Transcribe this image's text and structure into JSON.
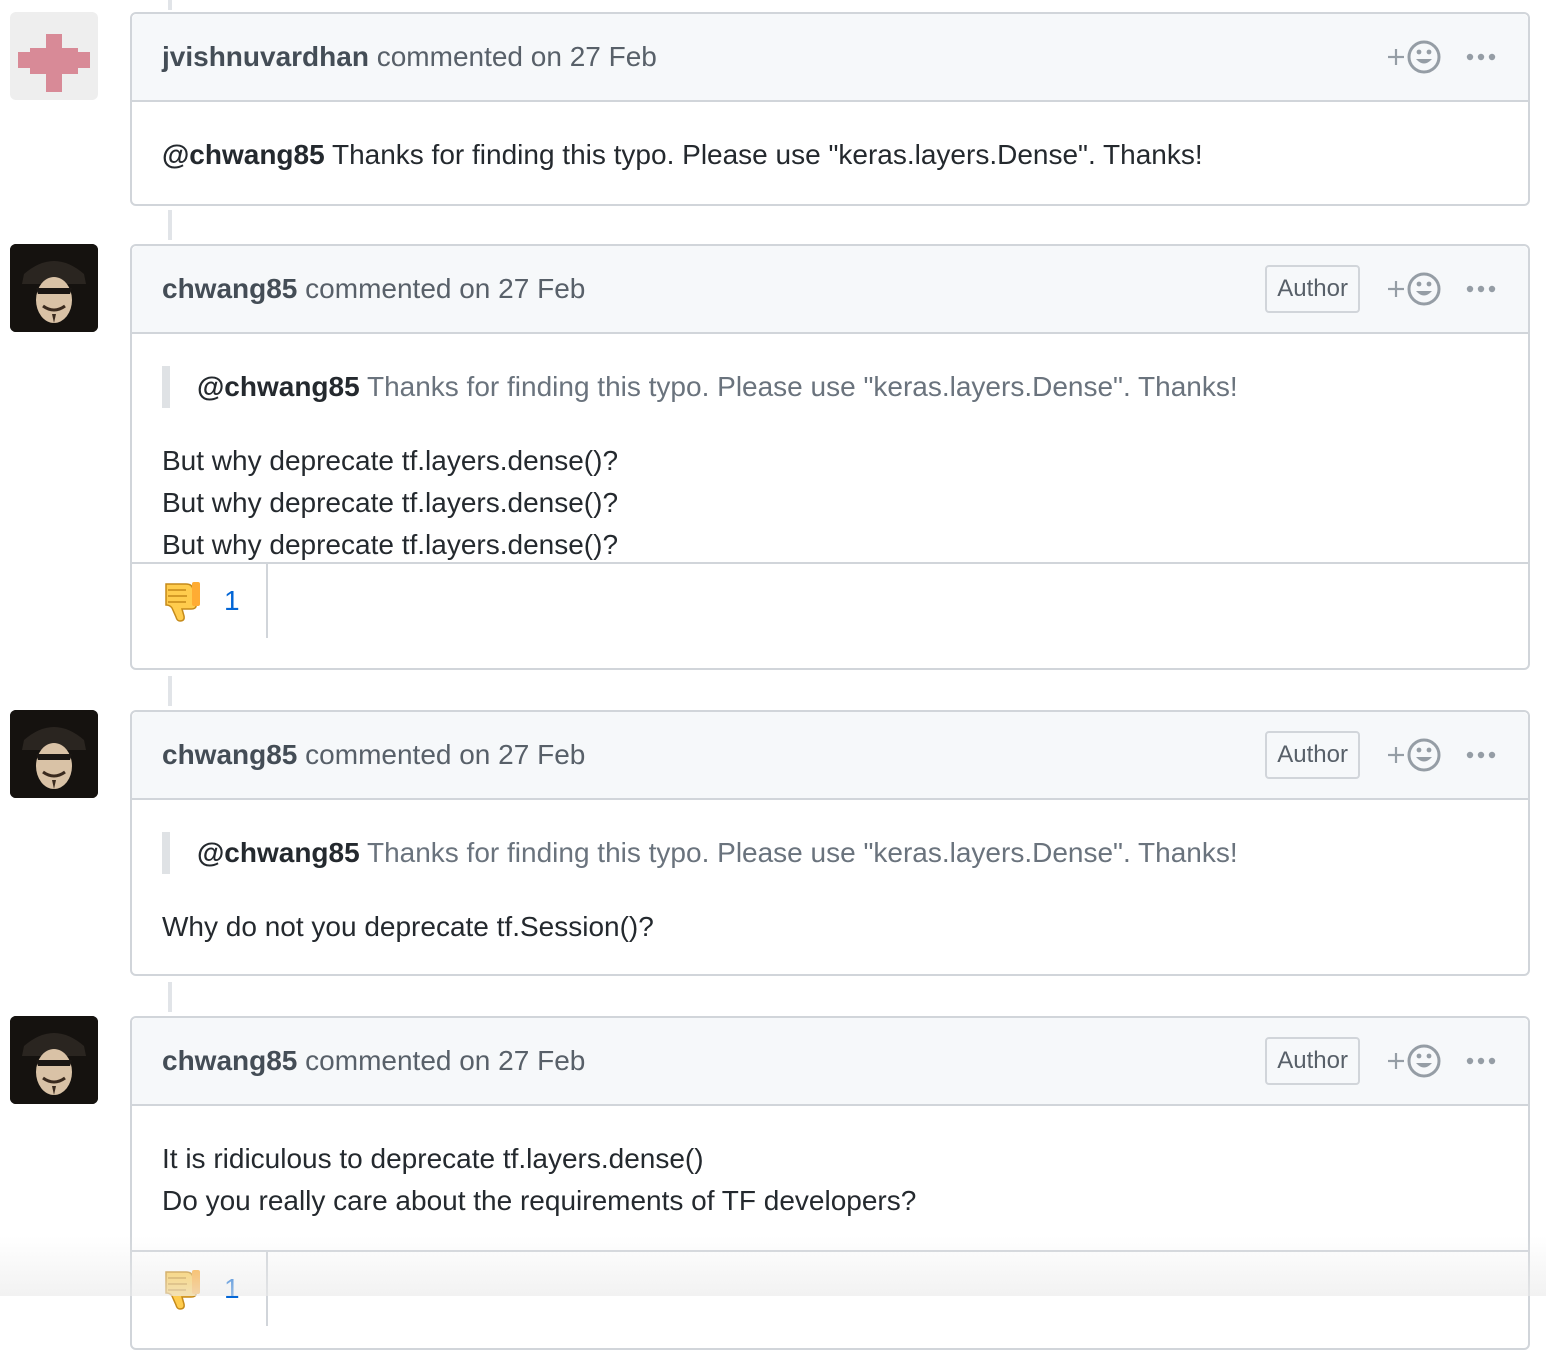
{
  "comments": [
    {
      "author": "jvishnuvardhan",
      "meta": " commented on 27 Feb",
      "is_author": false,
      "avatar": "identicon",
      "quote": null,
      "lines": [],
      "mention": "@chwang85",
      "mention_rest": " Thanks for finding this typo. Please use \"keras.layers.Dense\". Thanks!",
      "reactions": []
    },
    {
      "author": "chwang85",
      "meta": " commented on 27 Feb",
      "is_author": true,
      "badge": "Author",
      "avatar": "photo",
      "quote": {
        "mention": "@chwang85",
        "text": " Thanks for finding this typo. Please use \"keras.layers.Dense\". Thanks!"
      },
      "lines": [
        "But why deprecate tf.layers.dense()?",
        "But why deprecate tf.layers.dense()?",
        "But why deprecate tf.layers.dense()?"
      ],
      "reactions": [
        {
          "icon": "thumbs-down-icon",
          "count": "1"
        }
      ]
    },
    {
      "author": "chwang85",
      "meta": " commented on 27 Feb",
      "is_author": true,
      "badge": "Author",
      "avatar": "photo",
      "quote": {
        "mention": "@chwang85",
        "text": " Thanks for finding this typo. Please use \"keras.layers.Dense\". Thanks!"
      },
      "lines": [
        "Why do not you deprecate tf.Session()?"
      ],
      "reactions": []
    },
    {
      "author": "chwang85",
      "meta": " commented on 27 Feb",
      "is_author": true,
      "badge": "Author",
      "avatar": "photo",
      "quote": null,
      "lines": [
        "It is ridiculous to deprecate tf.layers.dense()",
        "Do you really care about the requirements of TF developers?"
      ],
      "reactions": [
        {
          "icon": "thumbs-down-icon",
          "count": "1"
        }
      ]
    }
  ],
  "icons": {
    "add_reaction": "smiley-plus-icon",
    "more": "kebab-horizontal-icon"
  },
  "colors": {
    "link": "#0366d6",
    "border": "#d1d5da",
    "header_bg": "#f6f8fa",
    "identicon": "#d88a97"
  }
}
